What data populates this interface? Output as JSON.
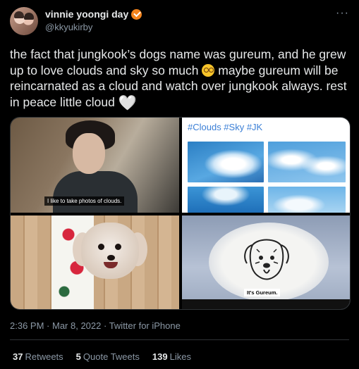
{
  "author": {
    "display_name": "vinnie yoongi day",
    "handle": "@kkyukirby",
    "badge_color": "#f4841c"
  },
  "menu_icon": "more-horizontal-icon",
  "tweet": {
    "text_part1": "the fact that jungkook’s dogs name was gureum, and he grew up to love clouds and sky so much ",
    "emoji1": "pleading-face-emoji",
    "text_part2": " maybe gureum will be reincarnated as a cloud and watch over jungkook always. rest in peace little cloud ",
    "emoji2": "white-heart-emoji",
    "heart_glyph": "🤍"
  },
  "media": {
    "image1_subtitle": "I like to take photos of clouds.",
    "image2_hashtags": "#Clouds #Sky #JK",
    "image4_caption": "It's Gureum."
  },
  "meta": {
    "time": "2:36 PM",
    "sep1": " · ",
    "date": "Mar 8, 2022",
    "sep2": " · ",
    "source": "Twitter for iPhone"
  },
  "stats": {
    "retweets_count": "37",
    "retweets_label": "Retweets",
    "quotes_count": "5",
    "quotes_label": "Quote Tweets",
    "likes_count": "139",
    "likes_label": "Likes"
  }
}
